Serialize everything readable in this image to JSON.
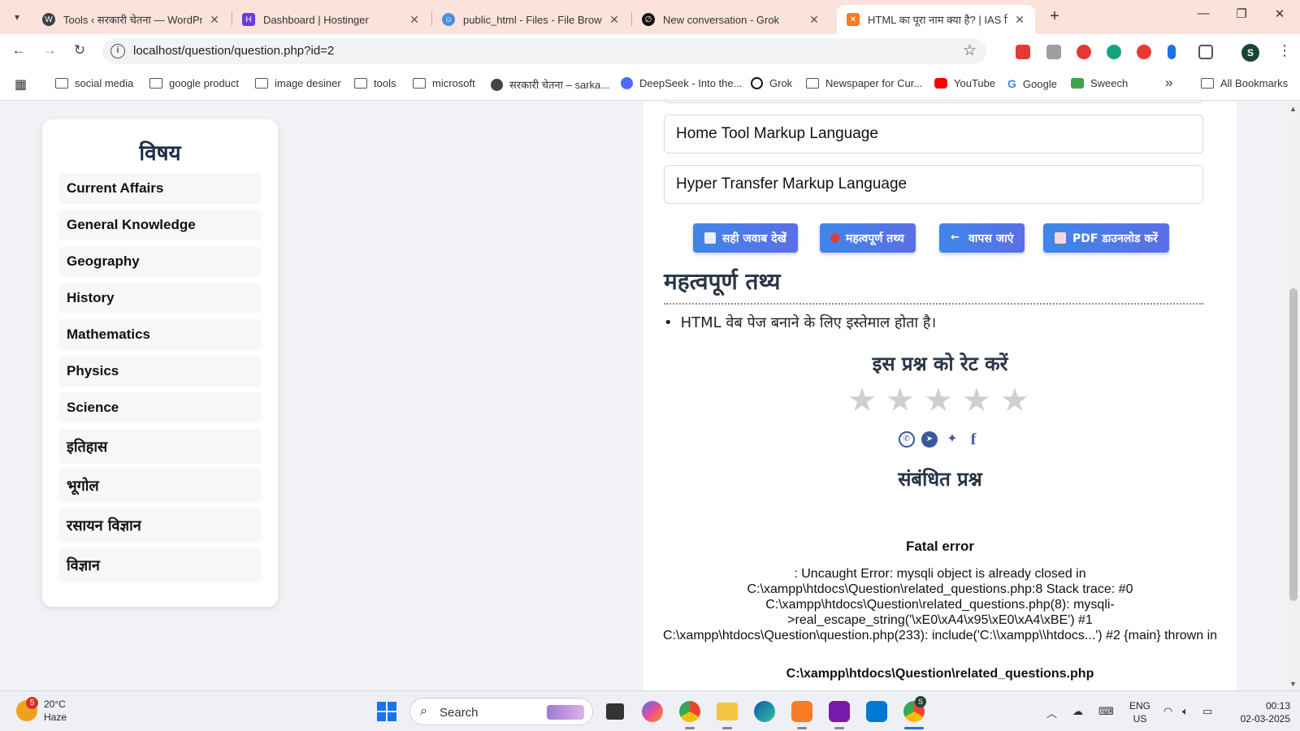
{
  "browser": {
    "tabs": [
      {
        "title": "Tools ‹ सरकारी चेतना — WordPress",
        "favicon": "wordpress-icon",
        "color": "#3c4043"
      },
      {
        "title": "Dashboard | Hostinger",
        "favicon": "hostinger-icon",
        "color": "#673de6"
      },
      {
        "title": "public_html - Files - File Browser",
        "favicon": "file-browser-icon",
        "color": "#4a90e2"
      },
      {
        "title": "New conversation - Grok",
        "favicon": "grok-icon",
        "color": "#111111"
      },
      {
        "title": "HTML का पूरा नाम क्या है? | IAS हिंदी",
        "favicon": "xampp-icon",
        "color": "#fb7a24"
      }
    ],
    "url": "localhost/question/question.php?id=2",
    "profile_initial": "S",
    "bookmarks": [
      {
        "label": "social media",
        "icon": "folder-icon"
      },
      {
        "label": "google product",
        "icon": "folder-icon"
      },
      {
        "label": "image desiner",
        "icon": "folder-icon"
      },
      {
        "label": "tools",
        "icon": "folder-icon"
      },
      {
        "label": "microsoft",
        "icon": "folder-icon"
      },
      {
        "label": "सरकारी चेतना – sarka...",
        "icon": "globe-icon"
      },
      {
        "label": "DeepSeek - Into the...",
        "icon": "deepseek-icon"
      },
      {
        "label": "Grok",
        "icon": "grok-icon"
      },
      {
        "label": "Newspaper for Cur...",
        "icon": "folder-icon"
      },
      {
        "label": "YouTube",
        "icon": "youtube-icon"
      },
      {
        "label": "Google",
        "icon": "google-icon"
      },
      {
        "label": "Sweech",
        "icon": "sweech-icon"
      }
    ],
    "all_bookmarks": "All Bookmarks",
    "more_chevron": "»"
  },
  "sidebar": {
    "title": "विषय",
    "subjects": [
      "Current Affairs",
      "General Knowledge",
      "Geography",
      "History",
      "Mathematics",
      "Physics",
      "Science",
      "इतिहास",
      "भूगोल",
      "रसायन विज्ञान",
      "विज्ञान"
    ]
  },
  "question": {
    "options": [
      "Home Tool Markup Language",
      "Hyper Transfer Markup Language"
    ],
    "buttons": [
      {
        "label": "सही जवाब देखें",
        "icon": "book-icon"
      },
      {
        "label": "महत्वपूर्ण तथ्य",
        "icon": "pin-icon"
      },
      {
        "label": "वापस जाएं",
        "icon": "back-arrow-icon"
      },
      {
        "label": "PDF डाउनलोड करें",
        "icon": "pdf-icon"
      }
    ],
    "facts_heading": "महत्वपूर्ण तथ्य",
    "facts": [
      "HTML वेब पेज बनाने के लिए इस्तेमाल होता है।"
    ],
    "rating_heading": "इस प्रश्न को रेट करें",
    "rating": {
      "value": 0,
      "max": 5
    },
    "share_icons": [
      "whatsapp-icon",
      "telegram-icon",
      "twitter-icon",
      "facebook-icon"
    ],
    "related_heading": "संबंधित प्रश्न",
    "error": {
      "title": "Fatal error",
      "message": ": Uncaught Error: mysqli object is already closed in C:\\xampp\\htdocs\\Question\\related_questions.php:8 Stack trace: #0 C:\\xampp\\htdocs\\Question\\related_questions.php(8): mysqli->real_escape_string('\\xE0\\xA4\\x95\\xE0\\xA4\\xBE') #1 C:\\xampp\\htdocs\\Question\\question.php(233): include('C:\\\\xampp\\\\htdocs...') #2 {main} thrown in",
      "cut_line": "C:\\xampp\\htdocs\\Question\\related_questions.php"
    }
  },
  "taskbar": {
    "weather": {
      "temp": "20°C",
      "desc": "Haze",
      "badge": "5"
    },
    "search_label": "Search",
    "lang": {
      "line1": "ENG",
      "line2": "US"
    },
    "clock": {
      "time": "00:13",
      "date": "02-03-2025"
    },
    "chrome_badge": "S"
  },
  "colors": {
    "accent_button": "#4a7de8",
    "heading": "#283548"
  }
}
